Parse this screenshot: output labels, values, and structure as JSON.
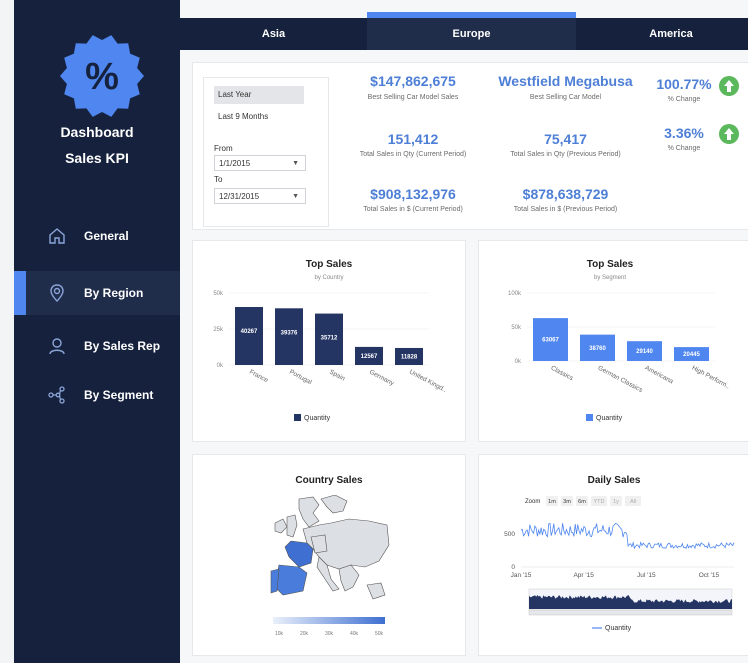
{
  "sidebar": {
    "logo_symbol": "%",
    "title1": "Dashboard",
    "title2": "Sales KPI",
    "items": [
      {
        "label": "General",
        "icon": "home-icon"
      },
      {
        "label": "By Region",
        "icon": "location-pin-icon"
      },
      {
        "label": "By Sales Rep",
        "icon": "person-icon"
      },
      {
        "label": "By Segment",
        "icon": "share-icon"
      }
    ],
    "active_item": "By Region"
  },
  "tabs": [
    {
      "label": "Asia"
    },
    {
      "label": "Europe"
    },
    {
      "label": "America"
    }
  ],
  "active_tab": "Europe",
  "filter": {
    "presets": [
      "Last Year",
      "Last 9 Months"
    ],
    "from_label": "From",
    "from_value": "1/1/2015",
    "to_label": "To",
    "to_value": "12/31/2015"
  },
  "kpis": {
    "best_selling_sales": {
      "value": "$147,862,675",
      "label": "Best Selling Car Model Sales"
    },
    "best_model": {
      "value": "Westfield Megabusa",
      "label": "Best Selling Car Model"
    },
    "change1": {
      "value": "100.77%",
      "label": "% Change"
    },
    "qty_current": {
      "value": "151,412",
      "label": "Total Sales in Qty (Current Period)"
    },
    "qty_previous": {
      "value": "75,417",
      "label": "Total Sales in Qty (Previous Period)"
    },
    "change2": {
      "value": "3.36%",
      "label": "% Change"
    },
    "usd_current": {
      "value": "$908,132,976",
      "label": "Total Sales in $ (Current Period)"
    },
    "usd_previous": {
      "value": "$878,638,729",
      "label": "Total Sales in $ (Previous Period)"
    }
  },
  "colors": {
    "dark_bar": "#243463",
    "light_bar": "#4f86ef",
    "accent": "#4e7fd6",
    "up_green": "#5cb85c"
  },
  "chart_data": [
    {
      "type": "bar",
      "title": "Top Sales",
      "subtitle": "by Country",
      "categories": [
        "France",
        "Portugal",
        "Spain",
        "Germany",
        "United Kingd.."
      ],
      "series": [
        {
          "name": "Quantity",
          "values": [
            40267,
            39376,
            35712,
            12567,
            11828
          ]
        }
      ],
      "yticks": [
        "0k",
        "25k",
        "50k"
      ],
      "ylim": [
        0,
        50000
      ]
    },
    {
      "type": "bar",
      "title": "Top Sales",
      "subtitle": "by Segment",
      "categories": [
        "Classics",
        "German Classics",
        "Americana",
        "High Perform.."
      ],
      "series": [
        {
          "name": "Quantity",
          "values": [
            63067,
            38760,
            29140,
            20445
          ]
        }
      ],
      "yticks": [
        "0k",
        "50k",
        "100k"
      ],
      "ylim": [
        0,
        100000
      ]
    },
    {
      "type": "heatmap",
      "title": "Country Sales",
      "scale_labels": [
        "10k",
        "20k",
        "30k",
        "40k",
        "50k"
      ]
    },
    {
      "type": "line",
      "title": "Daily Sales",
      "zoom_label": "Zoom",
      "zoom_buttons": [
        "1m",
        "3m",
        "6m",
        "YTD",
        "1y",
        "All"
      ],
      "x_ticks": [
        "Jan '15",
        "Apr '15",
        "Jul '15",
        "Oct '15"
      ],
      "y_ticks": [
        "0",
        "500"
      ],
      "series": [
        {
          "name": "Quantity"
        }
      ]
    }
  ]
}
